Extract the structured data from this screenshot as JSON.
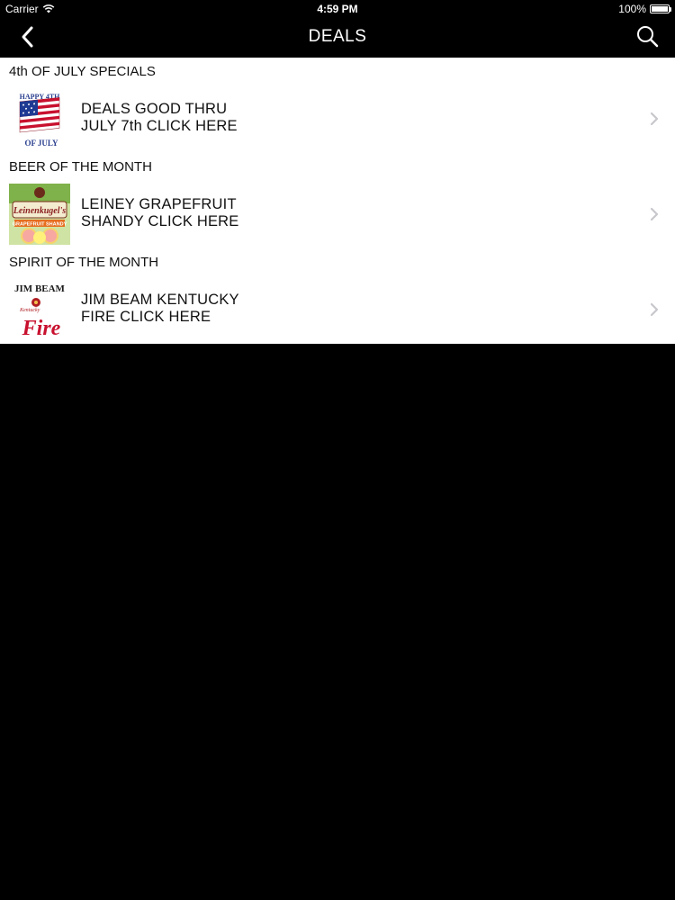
{
  "status_bar": {
    "carrier": "Carrier",
    "time": "4:59 PM",
    "battery": "100%",
    "battery_level": 1.0
  },
  "nav": {
    "title": "DEALS",
    "back_icon": "chevron-left-icon",
    "search_icon": "search-icon"
  },
  "sections": [
    {
      "header": "4th OF JULY SPECIALS",
      "item": {
        "line1": "DEALS GOOD THRU",
        "line2": "JULY 7th CLICK HERE",
        "image_icon": "july-4th-flag-image",
        "logo_text": "HAPPY 4TH OF JULY"
      }
    },
    {
      "header": "BEER OF THE MONTH",
      "item": {
        "line1": "LEINEY GRAPEFRUIT",
        "line2": "SHANDY CLICK HERE",
        "image_icon": "leinenkugels-shandy-image",
        "logo_text": "Leinenkugel's GRAPEFRUIT SHANDY"
      }
    },
    {
      "header": "SPIRIT OF THE MONTH",
      "item": {
        "line1": "JIM BEAM KENTUCKY",
        "line2": "FIRE CLICK HERE",
        "image_icon": "jim-beam-fire-image",
        "logo_text": "JIM BEAM Kentucky Fire"
      }
    }
  ],
  "colors": {
    "bar_background": "#000000",
    "content_background": "#ffffff",
    "chevron": "#c7c7cc"
  }
}
